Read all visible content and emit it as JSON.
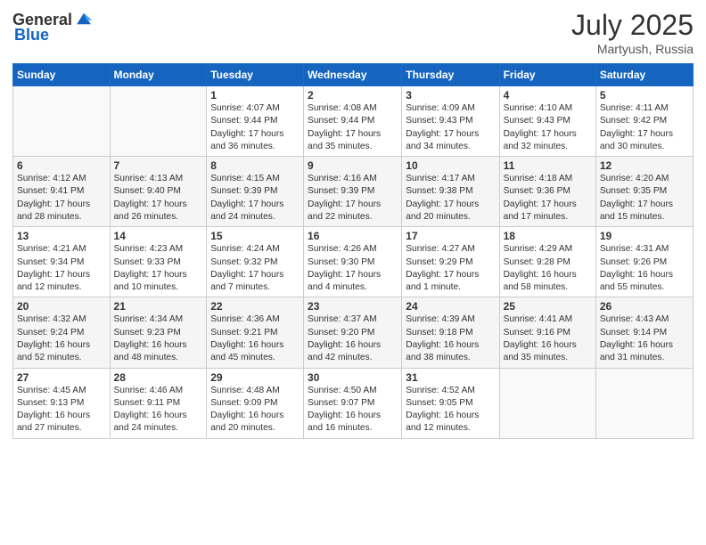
{
  "logo": {
    "general": "General",
    "blue": "Blue"
  },
  "title": {
    "month_year": "July 2025",
    "location": "Martyush, Russia"
  },
  "weekdays": [
    "Sunday",
    "Monday",
    "Tuesday",
    "Wednesday",
    "Thursday",
    "Friday",
    "Saturday"
  ],
  "weeks": [
    [
      {
        "day": "",
        "sunrise": "",
        "sunset": "",
        "daylight": ""
      },
      {
        "day": "",
        "sunrise": "",
        "sunset": "",
        "daylight": ""
      },
      {
        "day": "1",
        "sunrise": "Sunrise: 4:07 AM",
        "sunset": "Sunset: 9:44 PM",
        "daylight": "Daylight: 17 hours and 36 minutes."
      },
      {
        "day": "2",
        "sunrise": "Sunrise: 4:08 AM",
        "sunset": "Sunset: 9:44 PM",
        "daylight": "Daylight: 17 hours and 35 minutes."
      },
      {
        "day": "3",
        "sunrise": "Sunrise: 4:09 AM",
        "sunset": "Sunset: 9:43 PM",
        "daylight": "Daylight: 17 hours and 34 minutes."
      },
      {
        "day": "4",
        "sunrise": "Sunrise: 4:10 AM",
        "sunset": "Sunset: 9:43 PM",
        "daylight": "Daylight: 17 hours and 32 minutes."
      },
      {
        "day": "5",
        "sunrise": "Sunrise: 4:11 AM",
        "sunset": "Sunset: 9:42 PM",
        "daylight": "Daylight: 17 hours and 30 minutes."
      }
    ],
    [
      {
        "day": "6",
        "sunrise": "Sunrise: 4:12 AM",
        "sunset": "Sunset: 9:41 PM",
        "daylight": "Daylight: 17 hours and 28 minutes."
      },
      {
        "day": "7",
        "sunrise": "Sunrise: 4:13 AM",
        "sunset": "Sunset: 9:40 PM",
        "daylight": "Daylight: 17 hours and 26 minutes."
      },
      {
        "day": "8",
        "sunrise": "Sunrise: 4:15 AM",
        "sunset": "Sunset: 9:39 PM",
        "daylight": "Daylight: 17 hours and 24 minutes."
      },
      {
        "day": "9",
        "sunrise": "Sunrise: 4:16 AM",
        "sunset": "Sunset: 9:39 PM",
        "daylight": "Daylight: 17 hours and 22 minutes."
      },
      {
        "day": "10",
        "sunrise": "Sunrise: 4:17 AM",
        "sunset": "Sunset: 9:38 PM",
        "daylight": "Daylight: 17 hours and 20 minutes."
      },
      {
        "day": "11",
        "sunrise": "Sunrise: 4:18 AM",
        "sunset": "Sunset: 9:36 PM",
        "daylight": "Daylight: 17 hours and 17 minutes."
      },
      {
        "day": "12",
        "sunrise": "Sunrise: 4:20 AM",
        "sunset": "Sunset: 9:35 PM",
        "daylight": "Daylight: 17 hours and 15 minutes."
      }
    ],
    [
      {
        "day": "13",
        "sunrise": "Sunrise: 4:21 AM",
        "sunset": "Sunset: 9:34 PM",
        "daylight": "Daylight: 17 hours and 12 minutes."
      },
      {
        "day": "14",
        "sunrise": "Sunrise: 4:23 AM",
        "sunset": "Sunset: 9:33 PM",
        "daylight": "Daylight: 17 hours and 10 minutes."
      },
      {
        "day": "15",
        "sunrise": "Sunrise: 4:24 AM",
        "sunset": "Sunset: 9:32 PM",
        "daylight": "Daylight: 17 hours and 7 minutes."
      },
      {
        "day": "16",
        "sunrise": "Sunrise: 4:26 AM",
        "sunset": "Sunset: 9:30 PM",
        "daylight": "Daylight: 17 hours and 4 minutes."
      },
      {
        "day": "17",
        "sunrise": "Sunrise: 4:27 AM",
        "sunset": "Sunset: 9:29 PM",
        "daylight": "Daylight: 17 hours and 1 minute."
      },
      {
        "day": "18",
        "sunrise": "Sunrise: 4:29 AM",
        "sunset": "Sunset: 9:28 PM",
        "daylight": "Daylight: 16 hours and 58 minutes."
      },
      {
        "day": "19",
        "sunrise": "Sunrise: 4:31 AM",
        "sunset": "Sunset: 9:26 PM",
        "daylight": "Daylight: 16 hours and 55 minutes."
      }
    ],
    [
      {
        "day": "20",
        "sunrise": "Sunrise: 4:32 AM",
        "sunset": "Sunset: 9:24 PM",
        "daylight": "Daylight: 16 hours and 52 minutes."
      },
      {
        "day": "21",
        "sunrise": "Sunrise: 4:34 AM",
        "sunset": "Sunset: 9:23 PM",
        "daylight": "Daylight: 16 hours and 48 minutes."
      },
      {
        "day": "22",
        "sunrise": "Sunrise: 4:36 AM",
        "sunset": "Sunset: 9:21 PM",
        "daylight": "Daylight: 16 hours and 45 minutes."
      },
      {
        "day": "23",
        "sunrise": "Sunrise: 4:37 AM",
        "sunset": "Sunset: 9:20 PM",
        "daylight": "Daylight: 16 hours and 42 minutes."
      },
      {
        "day": "24",
        "sunrise": "Sunrise: 4:39 AM",
        "sunset": "Sunset: 9:18 PM",
        "daylight": "Daylight: 16 hours and 38 minutes."
      },
      {
        "day": "25",
        "sunrise": "Sunrise: 4:41 AM",
        "sunset": "Sunset: 9:16 PM",
        "daylight": "Daylight: 16 hours and 35 minutes."
      },
      {
        "day": "26",
        "sunrise": "Sunrise: 4:43 AM",
        "sunset": "Sunset: 9:14 PM",
        "daylight": "Daylight: 16 hours and 31 minutes."
      }
    ],
    [
      {
        "day": "27",
        "sunrise": "Sunrise: 4:45 AM",
        "sunset": "Sunset: 9:13 PM",
        "daylight": "Daylight: 16 hours and 27 minutes."
      },
      {
        "day": "28",
        "sunrise": "Sunrise: 4:46 AM",
        "sunset": "Sunset: 9:11 PM",
        "daylight": "Daylight: 16 hours and 24 minutes."
      },
      {
        "day": "29",
        "sunrise": "Sunrise: 4:48 AM",
        "sunset": "Sunset: 9:09 PM",
        "daylight": "Daylight: 16 hours and 20 minutes."
      },
      {
        "day": "30",
        "sunrise": "Sunrise: 4:50 AM",
        "sunset": "Sunset: 9:07 PM",
        "daylight": "Daylight: 16 hours and 16 minutes."
      },
      {
        "day": "31",
        "sunrise": "Sunrise: 4:52 AM",
        "sunset": "Sunset: 9:05 PM",
        "daylight": "Daylight: 16 hours and 12 minutes."
      },
      {
        "day": "",
        "sunrise": "",
        "sunset": "",
        "daylight": ""
      },
      {
        "day": "",
        "sunrise": "",
        "sunset": "",
        "daylight": ""
      }
    ]
  ]
}
